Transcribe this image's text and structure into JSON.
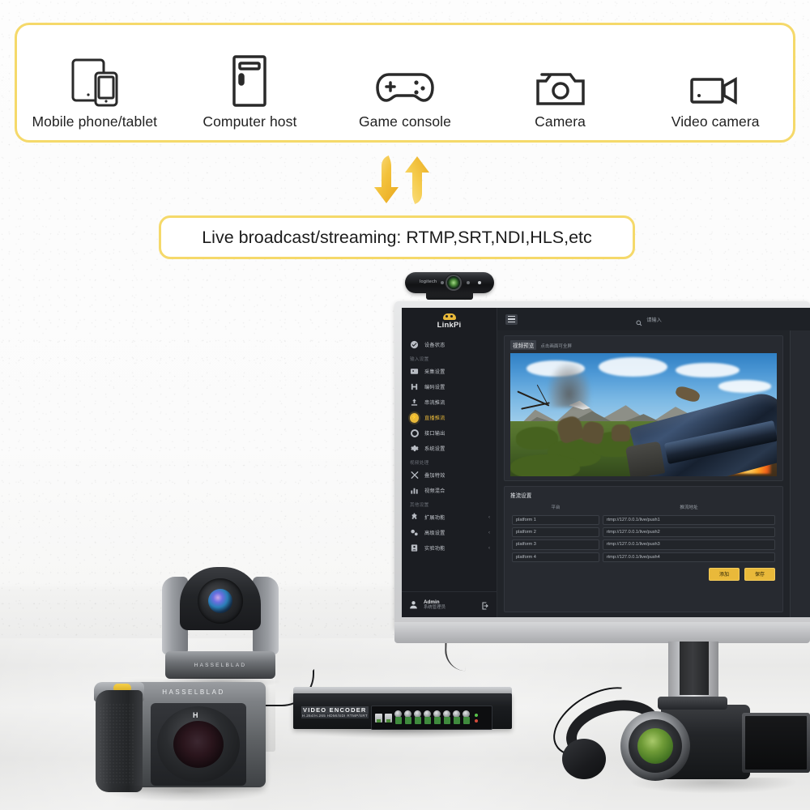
{
  "devices": {
    "items": [
      {
        "label": "Mobile phone/tablet",
        "icon": "tablet-phone-icon"
      },
      {
        "label": "Computer host",
        "icon": "desktop-tower-icon"
      },
      {
        "label": "Game console",
        "icon": "gamepad-icon"
      },
      {
        "label": "Camera",
        "icon": "camera-icon"
      },
      {
        "label": "Video camera",
        "icon": "video-camera-icon"
      }
    ]
  },
  "flow": {
    "up_arrow": "arrow-up-icon",
    "down_arrow": "arrow-down-icon"
  },
  "stream_banner": {
    "text": "Live broadcast/streaming: RTMP,SRT,NDI,HLS,etc"
  },
  "colors": {
    "banner_border": "#f5d96a",
    "arrow_gold": "#f0c23a",
    "ui_accent": "#e9b93a",
    "ui_panel": "#272a30",
    "ui_sidebar": "#1b1d22",
    "ui_background": "#212429"
  },
  "webcam": {
    "brand": "logitech"
  },
  "encoder": {
    "title": "VIDEO ENCODER",
    "subtitle": "H.264/H.265 HDMI/SDI RTMP/SRT"
  },
  "ptz_camera": {
    "brand": "HASSELBLAD"
  },
  "dslr_camera": {
    "brand": "HASSELBLAD",
    "lens_mark": "H"
  },
  "screen_ui": {
    "logo": "LinkPi",
    "topbar": {
      "menu_icon": "hamburger-icon",
      "search_icon": "search-icon",
      "search_placeholder": "请输入"
    },
    "sidebar": {
      "items": [
        {
          "label": "设备状态",
          "icon": "status-icon",
          "type": "item",
          "active": false
        },
        {
          "label": "输入设置",
          "type": "group"
        },
        {
          "label": "采集设置",
          "icon": "capture-icon",
          "type": "item",
          "active": false
        },
        {
          "label": "编码设置",
          "icon": "encode-icon",
          "type": "item",
          "active": false
        },
        {
          "label": "串流推流",
          "icon": "push-icon",
          "type": "item",
          "active": false
        },
        {
          "label": "直播推流",
          "icon": "live-icon",
          "type": "item",
          "active": true
        },
        {
          "label": "接口输出",
          "icon": "output-icon",
          "type": "item",
          "active": false
        },
        {
          "label": "系统设置",
          "icon": "settings-icon",
          "type": "item",
          "active": false
        },
        {
          "label": "视频处理",
          "type": "group"
        },
        {
          "label": "叠加特效",
          "icon": "overlay-icon",
          "type": "item",
          "active": false
        },
        {
          "label": "视频混合",
          "icon": "mix-icon",
          "type": "item",
          "active": false
        },
        {
          "label": "其他设置",
          "type": "group"
        },
        {
          "label": "扩展功能",
          "icon": "extension-icon",
          "type": "item",
          "active": false,
          "chevron": "‹"
        },
        {
          "label": "高级设置",
          "icon": "advanced-icon",
          "type": "item",
          "active": false,
          "chevron": "‹"
        },
        {
          "label": "实验功能",
          "icon": "lab-icon",
          "type": "item",
          "active": false,
          "chevron": "‹"
        }
      ],
      "footer": {
        "avatar_icon": "user-icon",
        "user_name": "Admin",
        "user_role": "系统管理员",
        "logout_icon": "logout-icon"
      }
    },
    "preview_card": {
      "title": "视频预览",
      "subtitle": "点击画面可全屏"
    },
    "table_card": {
      "title": "推流设置",
      "columns": [
        "平台",
        "推流地址"
      ],
      "rows": [
        {
          "platform": "platform 1",
          "url": "rtmp://127.0.0.1/live/push1"
        },
        {
          "platform": "platform 2",
          "url": "rtmp://127.0.0.1/live/push2"
        },
        {
          "platform": "platform 3",
          "url": "rtmp://127.0.0.1/live/push3"
        },
        {
          "platform": "platform 4",
          "url": "rtmp://127.0.0.1/live/push4"
        }
      ],
      "buttons": [
        {
          "label": "添加"
        },
        {
          "label": "保存"
        }
      ]
    }
  }
}
